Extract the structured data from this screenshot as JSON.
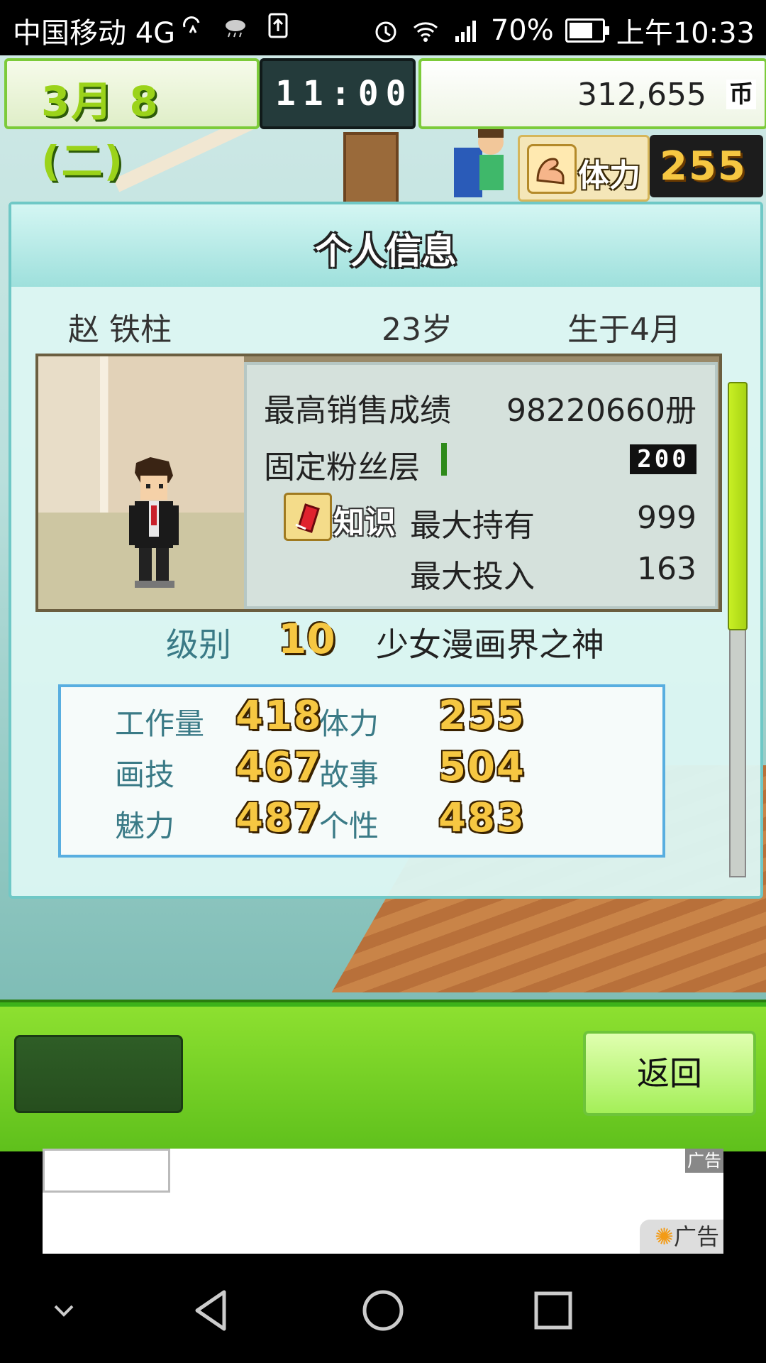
{
  "status_bar": {
    "carrier": "中国移动 4G",
    "battery": "70%",
    "time": "上午10:33"
  },
  "hud": {
    "date": "3月 8 (二)",
    "clock": "11:00",
    "money": "312,655",
    "money_unit": "币",
    "stamina_label": "体力",
    "stamina_value": "255"
  },
  "dialog": {
    "title": "个人信息",
    "name": "赵 铁柱",
    "age": "23岁",
    "birth": "生于4月",
    "best_sales_label": "最高销售成绩",
    "best_sales_value": "98220660册",
    "fans_label": "固定粉丝层",
    "fans_value": "200",
    "knowledge_label": "知识",
    "max_hold_label": "最大持有",
    "max_hold_value": "999",
    "max_invest_label": "最大投入",
    "max_invest_value": "163",
    "level_label": "级别",
    "level_value": "10",
    "level_title": "少女漫画界之神",
    "stats": [
      {
        "label": "工作量",
        "value": "418"
      },
      {
        "label": "体力",
        "value": "255"
      },
      {
        "label": "画技",
        "value": "467"
      },
      {
        "label": "故事",
        "value": "504"
      },
      {
        "label": "魅力",
        "value": "487"
      },
      {
        "label": "个性",
        "value": "483"
      }
    ]
  },
  "bottom": {
    "back_label": "返回"
  },
  "ad": {
    "tag": "广告"
  },
  "colors": {
    "accent_green": "#7ccb3a",
    "gold_number": "#f6c742",
    "stat_label": "#3a7a86",
    "stat_border": "#58aee0"
  }
}
